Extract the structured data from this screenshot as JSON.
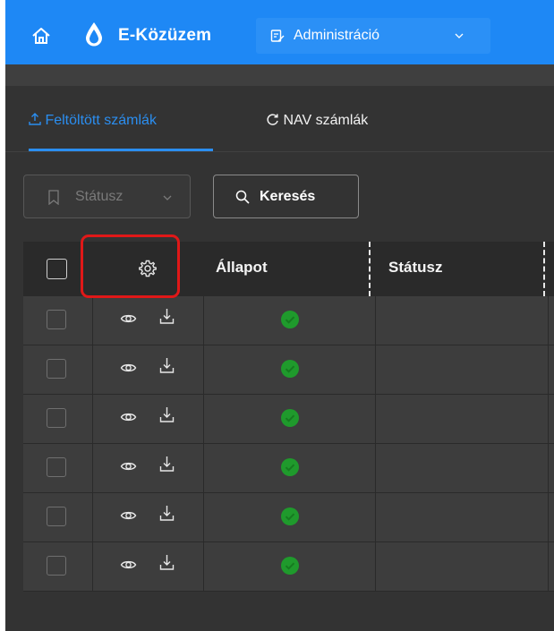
{
  "header": {
    "app_name": "E-Közüzem",
    "admin_menu_label": "Administráció",
    "icons": {
      "home": "home-icon",
      "logo": "drop-logo-icon",
      "admin": "edit-document-icon",
      "chevron": "chevron-down-icon"
    }
  },
  "tabs": [
    {
      "label": "Feltöltött számlák",
      "icon": "upload-icon",
      "active": true
    },
    {
      "label": "NAV számlák",
      "icon": "refresh-icon",
      "active": false
    }
  ],
  "filters": {
    "status_label": "Státusz",
    "search_label": "Keresés"
  },
  "table": {
    "columns": [
      "Állapot",
      "Státusz"
    ],
    "row_count": 6,
    "row_status": "ok"
  },
  "colors": {
    "accent": "#1e88f5",
    "tab_active": "#2b8ef0",
    "status_ok": "#1f9a2c",
    "highlight": "#e01818",
    "background": "#333333"
  }
}
